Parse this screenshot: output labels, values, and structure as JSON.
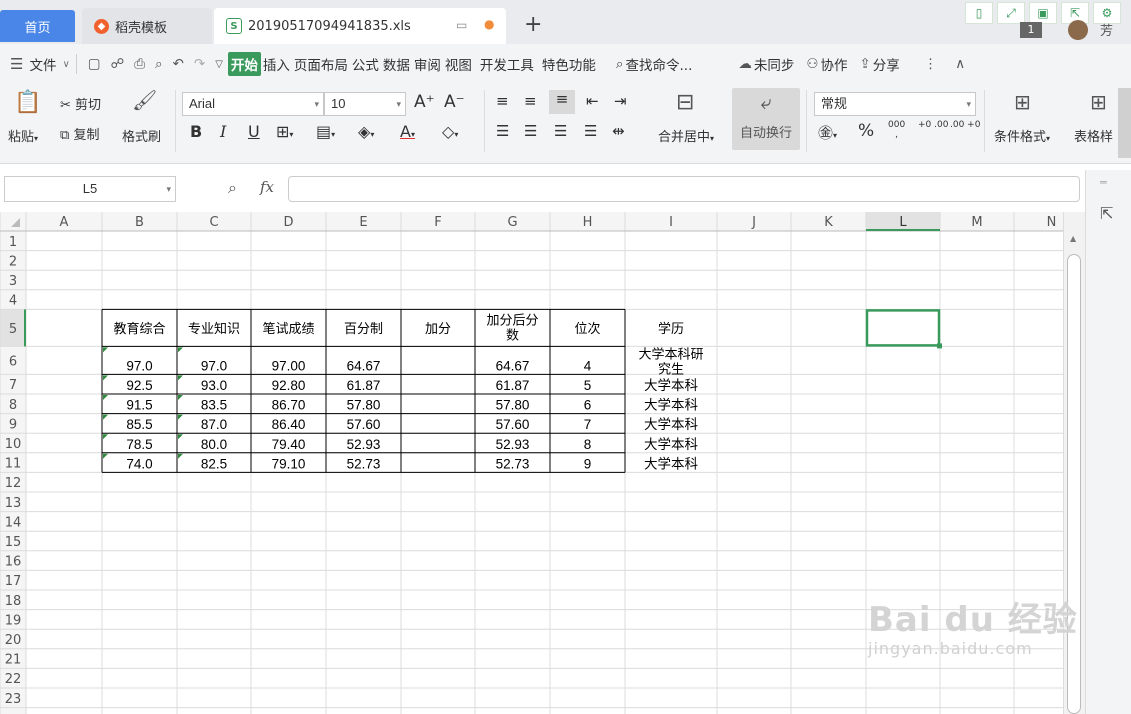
{
  "tabs": {
    "home": "首页",
    "template": "稻壳模板",
    "file": "20190517094941835.xls",
    "add": "+",
    "page_count": "1",
    "user_initial": "芳"
  },
  "menu": {
    "items": [
      "文件",
      "开始",
      "插入",
      "页面布局",
      "公式",
      "数据",
      "审阅",
      "视图",
      "开发工具",
      "特色功能"
    ],
    "search": "查找命令...",
    "sync": "未同步",
    "collab": "协作",
    "share": "分享"
  },
  "ribbon": {
    "paste": "粘贴",
    "cut": "剪切",
    "copy": "复制",
    "format_painter": "格式刷",
    "font_name": "Arial",
    "font_size": "10",
    "merge_center": "合并居中",
    "wrap_text": "自动换行",
    "number_format": "常规",
    "percent": "%",
    "thousands": "000",
    "inc_decimal": "+0 .00",
    "dec_decimal": ".00 +0",
    "cond_format": "条件格式",
    "table_style": "表格样"
  },
  "formula_bar": {
    "name_box": "L5",
    "fx": "fx",
    "value": ""
  },
  "sheet": {
    "columns": [
      "A",
      "B",
      "C",
      "D",
      "E",
      "F",
      "G",
      "H",
      "I",
      "J",
      "K",
      "L",
      "M",
      "N"
    ],
    "rows": [
      "1",
      "2",
      "3",
      "4",
      "5",
      "6",
      "7",
      "8",
      "9",
      "10",
      "11",
      "12",
      "13",
      "14",
      "15",
      "16",
      "17",
      "18",
      "19",
      "20",
      "21",
      "22",
      "23"
    ],
    "selected_cell": "L5",
    "table": {
      "header": [
        "教育综合",
        "专业知识",
        "笔试成绩",
        "百分制",
        "加分",
        "加分后分数",
        "位次",
        "学历"
      ],
      "rows": [
        [
          "97.0",
          "97.0",
          "97.00",
          "64.67",
          "",
          "64.67",
          "4",
          "大学本科研究生"
        ],
        [
          "92.5",
          "93.0",
          "92.80",
          "61.87",
          "",
          "61.87",
          "5",
          "大学本科"
        ],
        [
          "91.5",
          "83.5",
          "86.70",
          "57.80",
          "",
          "57.80",
          "6",
          "大学本科"
        ],
        [
          "85.5",
          "87.0",
          "86.40",
          "57.60",
          "",
          "57.60",
          "7",
          "大学本科"
        ],
        [
          "78.5",
          "80.0",
          "79.40",
          "52.93",
          "",
          "52.93",
          "8",
          "大学本科"
        ],
        [
          "74.0",
          "82.5",
          "79.10",
          "52.73",
          "",
          "52.73",
          "9",
          "大学本科"
        ]
      ]
    }
  },
  "watermark": {
    "brand": "Bai du 经验",
    "url": "jingyan.baidu.com"
  },
  "colors": {
    "accent": "#3a9a5c",
    "home_tab": "#4a86e8"
  }
}
